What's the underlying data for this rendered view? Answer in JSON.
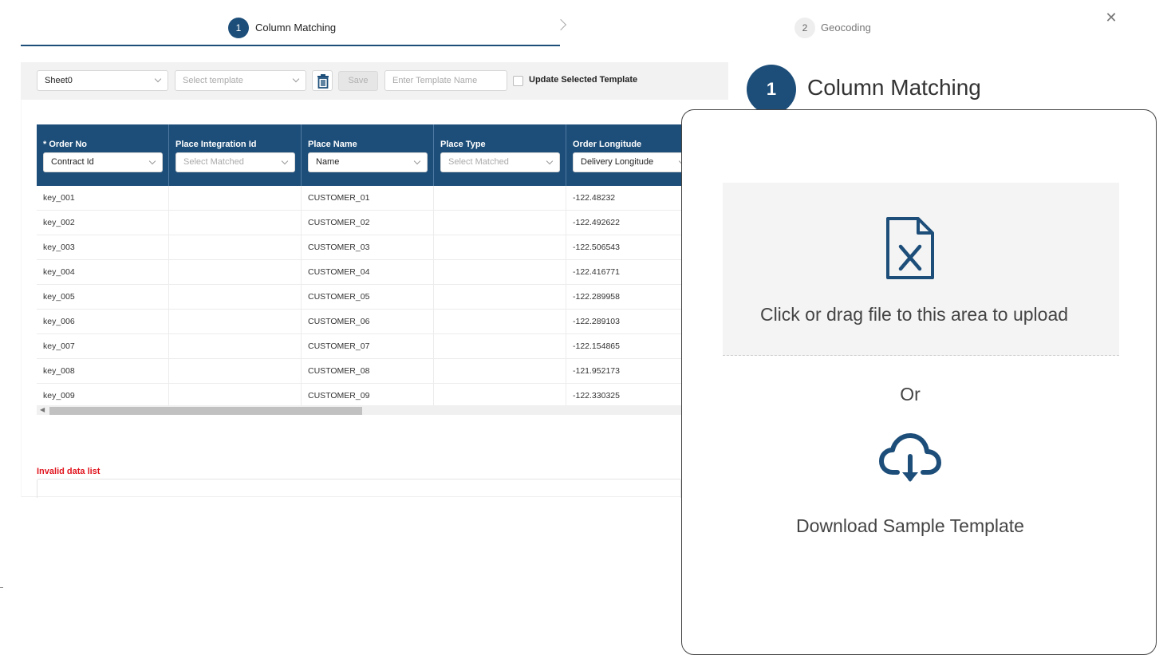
{
  "steps": [
    {
      "number": "1",
      "label": "Column Matching"
    },
    {
      "number": "2",
      "label": "Geocoding"
    }
  ],
  "close_glyph": "✕",
  "toolbar": {
    "sheet_value": "Sheet0",
    "template_placeholder": "Select template",
    "save_label": "Save",
    "template_name_placeholder": "Enter Template Name",
    "update_label": "Update Selected Template"
  },
  "table": {
    "columns": [
      {
        "title": "* Order No",
        "select_value": "Contract Id",
        "placeholder": false
      },
      {
        "title": "Place Integration Id",
        "select_value": "Select Matched",
        "placeholder": true
      },
      {
        "title": "Place Name",
        "select_value": "Name",
        "placeholder": false
      },
      {
        "title": "Place Type",
        "select_value": "Select Matched",
        "placeholder": true
      },
      {
        "title": "Order Longitude",
        "select_value": "Delivery Longitude",
        "placeholder": false
      }
    ],
    "rows": [
      [
        "key_001",
        "",
        "CUSTOMER_01",
        "",
        "-122.48232"
      ],
      [
        "key_002",
        "",
        "CUSTOMER_02",
        "",
        "-122.492622"
      ],
      [
        "key_003",
        "",
        "CUSTOMER_03",
        "",
        "-122.506543"
      ],
      [
        "key_004",
        "",
        "CUSTOMER_04",
        "",
        "-122.416771"
      ],
      [
        "key_005",
        "",
        "CUSTOMER_05",
        "",
        "-122.289958"
      ],
      [
        "key_006",
        "",
        "CUSTOMER_06",
        "",
        "-122.289103"
      ],
      [
        "key_007",
        "",
        "CUSTOMER_07",
        "",
        "-122.154865"
      ],
      [
        "key_008",
        "",
        "CUSTOMER_08",
        "",
        "-121.952173"
      ],
      [
        "key_009",
        "",
        "CUSTOMER_09",
        "",
        "-122.330325"
      ]
    ]
  },
  "invalid_title": "Invalid data list",
  "right_step": {
    "number": "1",
    "label": "Column Matching"
  },
  "upload": {
    "drop_text": "Click or drag file to this area to upload",
    "or_text": "Or",
    "download_text": "Download Sample Template"
  },
  "colors": {
    "primary": "#1d4e79",
    "error": "#e0141e"
  },
  "icons": {
    "delete": "trash-icon",
    "file": "excel-file-icon",
    "download": "cloud-download-icon"
  }
}
